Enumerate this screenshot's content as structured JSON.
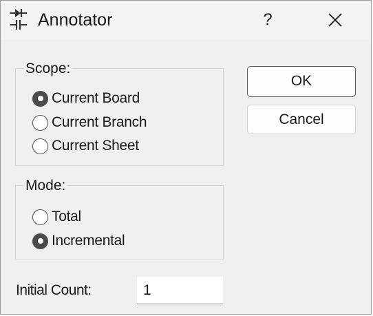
{
  "window": {
    "title": "Annotator",
    "help_label": "?",
    "app_icon": "diode-capacitor-icon",
    "close_icon": "close-icon"
  },
  "scope": {
    "label": "Scope:",
    "options": [
      {
        "label": "Current Board",
        "checked": true
      },
      {
        "label": "Current Branch",
        "checked": false
      },
      {
        "label": "Current Sheet",
        "checked": false
      }
    ]
  },
  "mode": {
    "label": "Mode:",
    "options": [
      {
        "label": "Total",
        "checked": false
      },
      {
        "label": "Incremental",
        "checked": true
      }
    ]
  },
  "buttons": {
    "ok_label": "OK",
    "cancel_label": "Cancel"
  },
  "initial_count": {
    "label": "Initial Count:",
    "value": "1"
  },
  "colors": {
    "dialog_bg": "#f0f0f0",
    "radio_checked": "#4a4a4a",
    "default_button_border": "#5a5a5a"
  }
}
